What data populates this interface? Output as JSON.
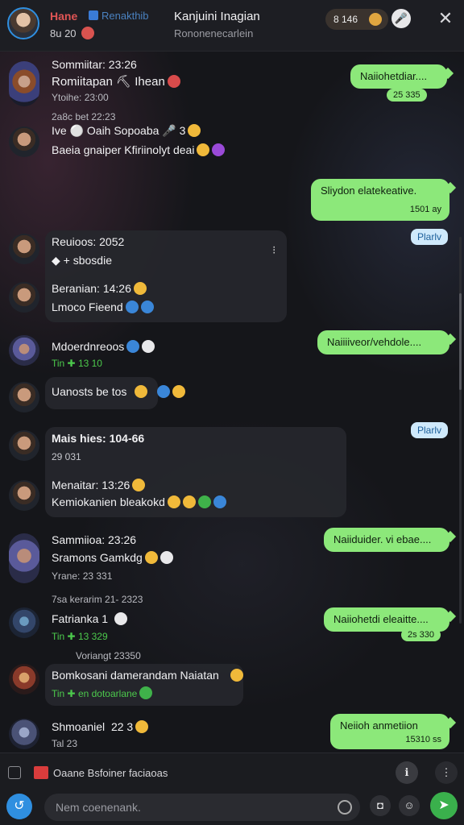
{
  "header": {
    "name": "Hane",
    "app_label": "Renakthib",
    "sub_label": "8u 20",
    "title": "Kanjuini Inagian",
    "status": "Rononenecarlein",
    "coins": "8 146",
    "close_glyph": "✕",
    "mic_glyph": "🎤"
  },
  "messages": {
    "m1": {
      "name": "Sommiitar: 23:26",
      "line": "Romiitapan ⛏ Ihean",
      "sub": "Ytoihe: 23:00",
      "sender_line": "2a8c bet 22:23"
    },
    "m2": {
      "line1": "Ive ⚪ Oaih Sopoaba 🎤 3",
      "line2": "Baeia gnaiper Kfiriinolyt deai"
    },
    "m3": {
      "name": "Reuioos: 2052",
      "line": "◆ + sbosdie"
    },
    "m4": {
      "name": "Beranian: 14:26",
      "line": "Lmoco Fieend"
    },
    "m5": {
      "name": "Mdoerdnreoos",
      "sub": "Tin ✚ 13 10"
    },
    "m6": {
      "line": "Uanosts be tos"
    },
    "m7": {
      "name": "Mais hies: 104-66",
      "sub": "29 031"
    },
    "m8": {
      "name": "Menaitar: 13:26",
      "line": "Kemiokanien bleakokd"
    },
    "m9": {
      "name": "Sammiioa: 23:26",
      "line": "Sramons Gamkdg",
      "sub": "Yrane: 23 331"
    },
    "m10": {
      "header": "7sa kerarim 21- 2323",
      "name": "Fatrianka 1",
      "sub": "Tin ✚ 13 329",
      "note": "Voriangt 23350"
    },
    "m11": {
      "line": "Bomkosani damerandam Naiatan",
      "sub": "Tin ✚ en dotoarlane"
    },
    "m12": {
      "name": "Shmoaniel",
      "time": "22 3",
      "sub": "Tal 23"
    }
  },
  "outgoing": {
    "o1": {
      "text": "Naiiohetdiar....",
      "time": "25 335"
    },
    "o2": {
      "text": "Sliydon elatekeative.",
      "time": "1501 ay"
    },
    "o3": {
      "text": "Naiiiiveor/vehdole....",
      "time": ""
    },
    "o4": {
      "text": "Naiiduider. vi ebae....",
      "time": ""
    },
    "o5": {
      "text": "Naiiohetdi eleaitte....",
      "time": "2s 330"
    },
    "o6": {
      "text": "Neiioh anmetiion",
      "time": "15310 ss"
    }
  },
  "play_labels": {
    "p1": "Plarlv",
    "p2": "Plarlv"
  },
  "composer": {
    "context_text": "Oaane Bsfoiner faciaoas",
    "placeholder": "Nem coenenank.",
    "plus_glyph": "↺",
    "send_glyph": "➤"
  }
}
